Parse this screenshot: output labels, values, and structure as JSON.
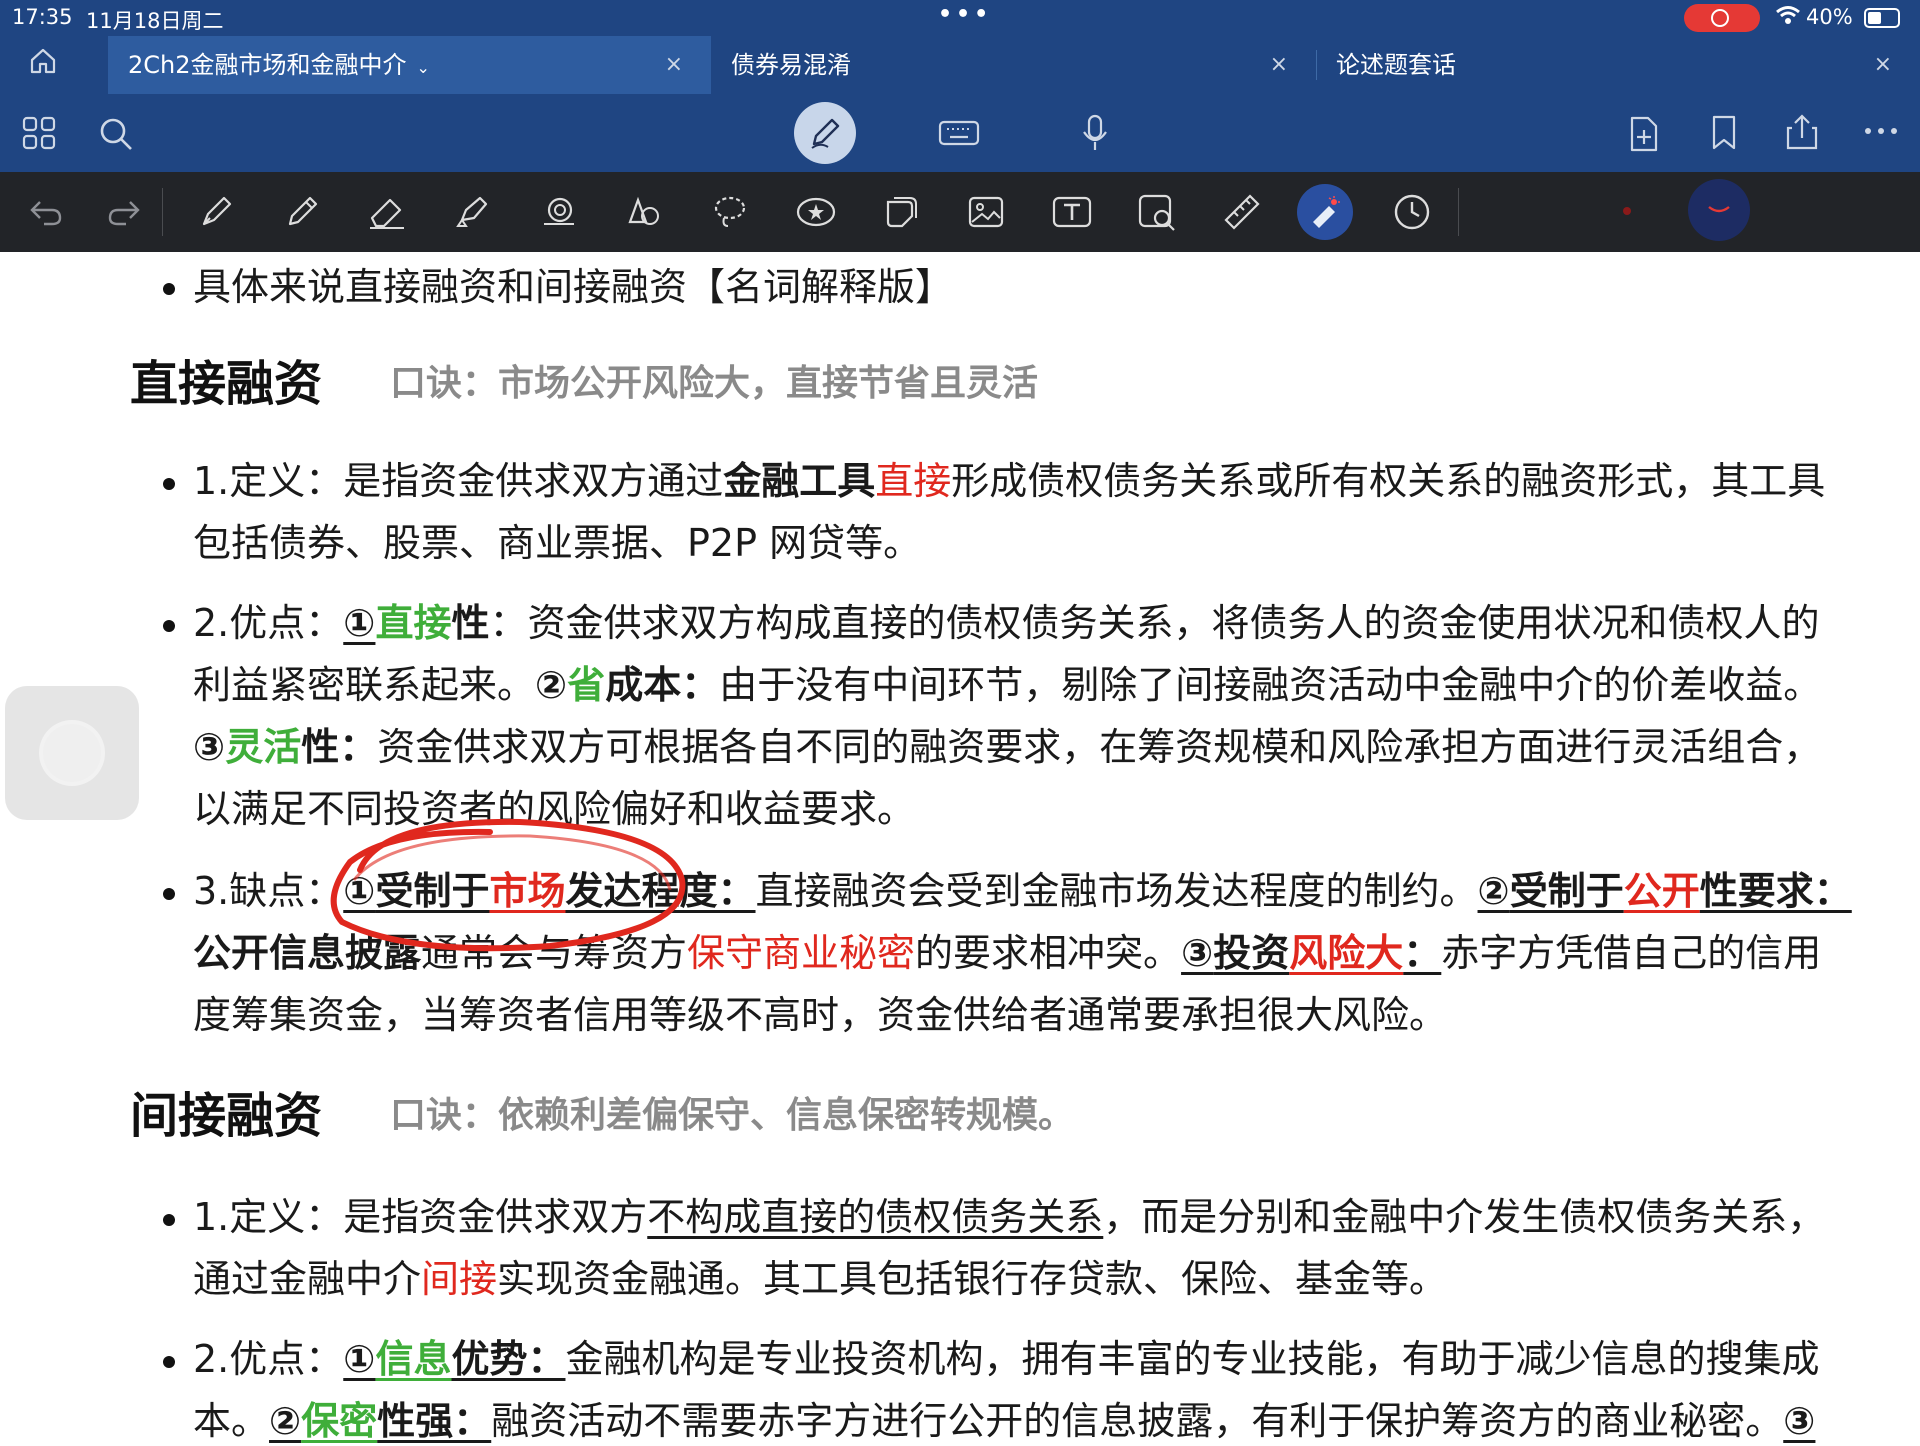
{
  "status_bar": {
    "time": "17:35",
    "date": "11月18日周二",
    "more": "•••",
    "battery": "40%"
  },
  "tabs": [
    {
      "label": "2Ch2金融市场和金融中介",
      "active": true
    },
    {
      "label": "债券易混淆",
      "active": false
    },
    {
      "label": "论述题套话",
      "active": false
    }
  ],
  "icons": {
    "close": "×",
    "chevron": "⌄"
  },
  "document": {
    "intro": "具体来说直接融资和间接融资【名词解释版】",
    "direct": {
      "heading": "直接融资",
      "mnemonic": "口诀：市场公开风险大，直接节省且灵活",
      "p1": {
        "a": "1.定义：是指资金供求双方通过",
        "b_bold": "金融工具",
        "c_red": "直接",
        "d": "形成债权债务关系或所有权关系的融资形式，其工具",
        "e": "包括债券、股票、商业票据、P2P 网贷等。"
      },
      "p2": {
        "a": "2.优点：",
        "n1": "①",
        "g1": "直接",
        "k1": "性",
        "t1": "：资金供求双方构成直接的债权债务关系，将债务人的资金使用状况和债权人的",
        "t2": "利益紧密联系起来。",
        "n2": "②",
        "g2": "省",
        "k2": "成本：",
        "t3": "由于没有中间环节，剔除了间接融资活动中金融中介的价差收益。",
        "n3": "③",
        "g3": "灵活",
        "k3": "性：",
        "t4": "资金供求双方可根据各自不同的融资要求，在筹资规模和风险承担方面进行灵活组合，",
        "t5": "以满足不同投资者的风险偏好和收益要求。"
      },
      "p3": {
        "a": "3.缺点：",
        "n1": "①",
        "k1": "受制于",
        "r1": "市场",
        "k1b": "发达程度",
        "c1": "：",
        "t1": "直接融资会受到金融市场发达程度的制约。",
        "n2": "②",
        "k2": "受制于",
        "r2": "公开",
        "k2b": "性要求：",
        "k3": "公开信息披露",
        "t2": "通常会与筹资方",
        "r3": "保守商业秘密",
        "t3": "的要求相冲突。",
        "n3": "③",
        "k4": "投资",
        "r4": "风险大",
        "c4": "：",
        "t4": "赤字方凭借自己的信用",
        "t5": "度筹集资金，当筹资者信用等级不高时，资金供给者通常要承担很大风险。"
      }
    },
    "indirect": {
      "heading": "间接融资",
      "mnemonic": "口诀：依赖利差偏保守、信息保密转规模。",
      "p1": {
        "a": "1.定义：是指资金供求双方",
        "u": "不构成直接的债权债务关系",
        "b": "，而是分别和金融中介发生债权债务关系，",
        "c": "通过金融中介",
        "r": "间接",
        "d": "实现资金融通。其工具包括银行存贷款、保险、基金等。"
      },
      "p2": {
        "a": "2.优点：",
        "n1": "①",
        "g1": "信息",
        "k1": "优势：",
        "t1": "金融机构是专业投资机构，拥有丰富的专业技能，有助于减少信息的搜集成",
        "t2": "本。",
        "n2": "②",
        "g2": "保密",
        "k2": "性强：",
        "t3": "融资活动不需要赤字方进行公开的信息披露，有利于保护筹资方的商业秘密。",
        "n3": "③"
      }
    }
  }
}
